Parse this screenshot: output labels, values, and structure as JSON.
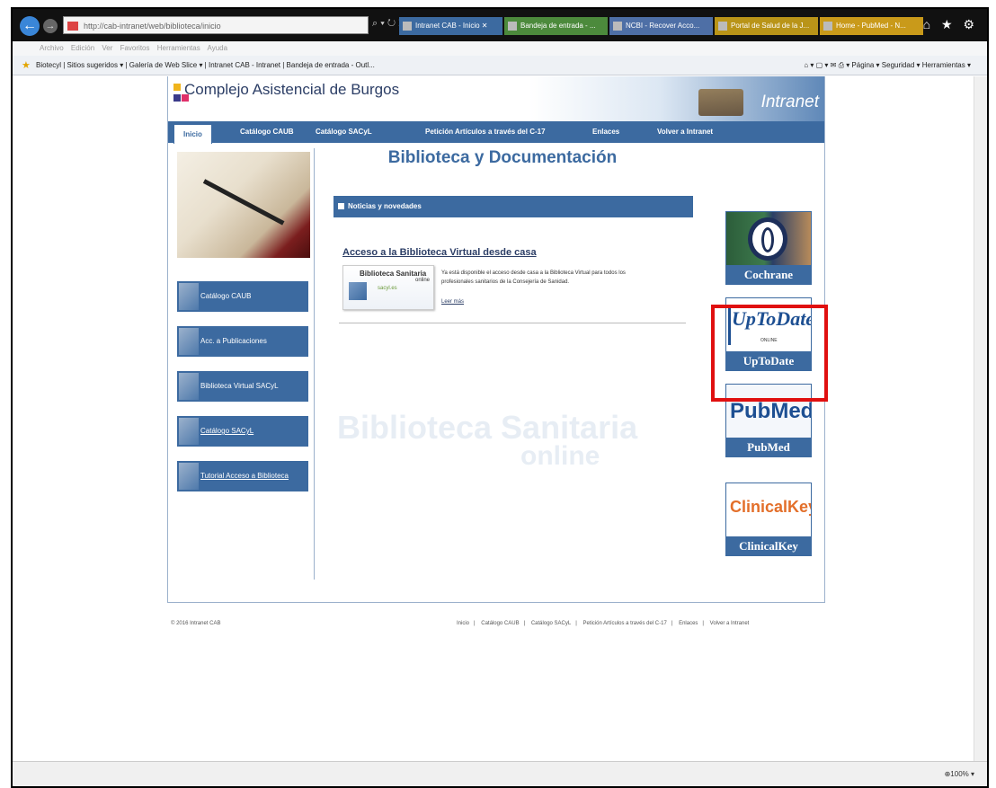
{
  "browser": {
    "address": "http://cab-intranet/web/biblioteca/inicio",
    "address_controls": "⌕ ▾ ↻ ✕",
    "tabs": [
      {
        "label": "Intranet CAB - Inicio ✕",
        "color": "#3c6aa0"
      },
      {
        "label": "Bandeja de entrada - ...",
        "color": "#4c8a3c"
      },
      {
        "label": "NCBI - Recover Acco...",
        "color": "#4e6fa6"
      },
      {
        "label": "Portal de Salud de la J...",
        "color": "#b99418"
      },
      {
        "label": "Home - PubMed - N...",
        "color": "#c99a1a"
      }
    ],
    "toolbar_icons": "⌂ ★ ⚙",
    "menu": "Archivo  Edición  Ver  Favoritos  Herramientas  Ayuda",
    "favorites": "Biotecyl  |  Sitios sugeridos ▾  |  Galería de Web Slice ▾  |  Intranet CAB - Intranet  |  Bandeja de entrada - Outl...",
    "commands": "⌂ ▾ ▢ ▾ ✉ ⎙ ▾  Página ▾  Seguridad ▾  Herramientas ▾",
    "zoom": "⊕100% ▾"
  },
  "site": {
    "name": "Complejo Asistencial de Burgos",
    "intranet": "Intranet",
    "nav": [
      "Inicio",
      "Catálogo CAUB",
      "Catálogo SACyL",
      "Petición Artículos a través del C-17",
      "Enlaces",
      "Volver a Intranet"
    ],
    "sidebar": [
      {
        "label": "Catálogo CAUB",
        "underline": false
      },
      {
        "label": "Acc. a Publicaciones",
        "underline": false
      },
      {
        "label": "Biblioteca Virtual SACyL",
        "underline": false
      },
      {
        "label": "Catálogo SACyL",
        "underline": true
      },
      {
        "label": "Tutorial Acceso a Biblioteca",
        "underline": true
      }
    ],
    "title": "Biblioteca y Documentación",
    "news_header": "Noticias y novedades",
    "article": {
      "title": "Acceso a la Biblioteca Virtual desde casa",
      "logo_line1": "Biblioteca Sanitaria",
      "logo_line2": "online",
      "logo_line3": "sacyl.es",
      "text": "Ya está disponible el acceso desde casa a la Biblioteca Virtual para todos los profesionales sanitarios de la Consejería de Sanidad.",
      "more": "Leer más"
    },
    "watermark_1": "Biblioteca Sanitaria",
    "watermark_2": "online",
    "banners": {
      "cochrane": "Cochrane",
      "uptodate_logo": "UpToDate",
      "uptodate_sub": "ONLINE",
      "uptodate": "UpToDate",
      "pubmed_logo": "PubMed",
      "pubmed": "PubMed",
      "clinicalkey_logo": "ClinicalKey",
      "clinicalkey": "ClinicalKey"
    },
    "footer_copy": "© 2016 Intranet CAB",
    "footer_links": [
      "Inicio",
      "Catálogo CAUB",
      "Catálogo SACyL",
      "Petición Artículos a través del C-17",
      "Enlaces",
      "Volver a Intranet"
    ]
  }
}
